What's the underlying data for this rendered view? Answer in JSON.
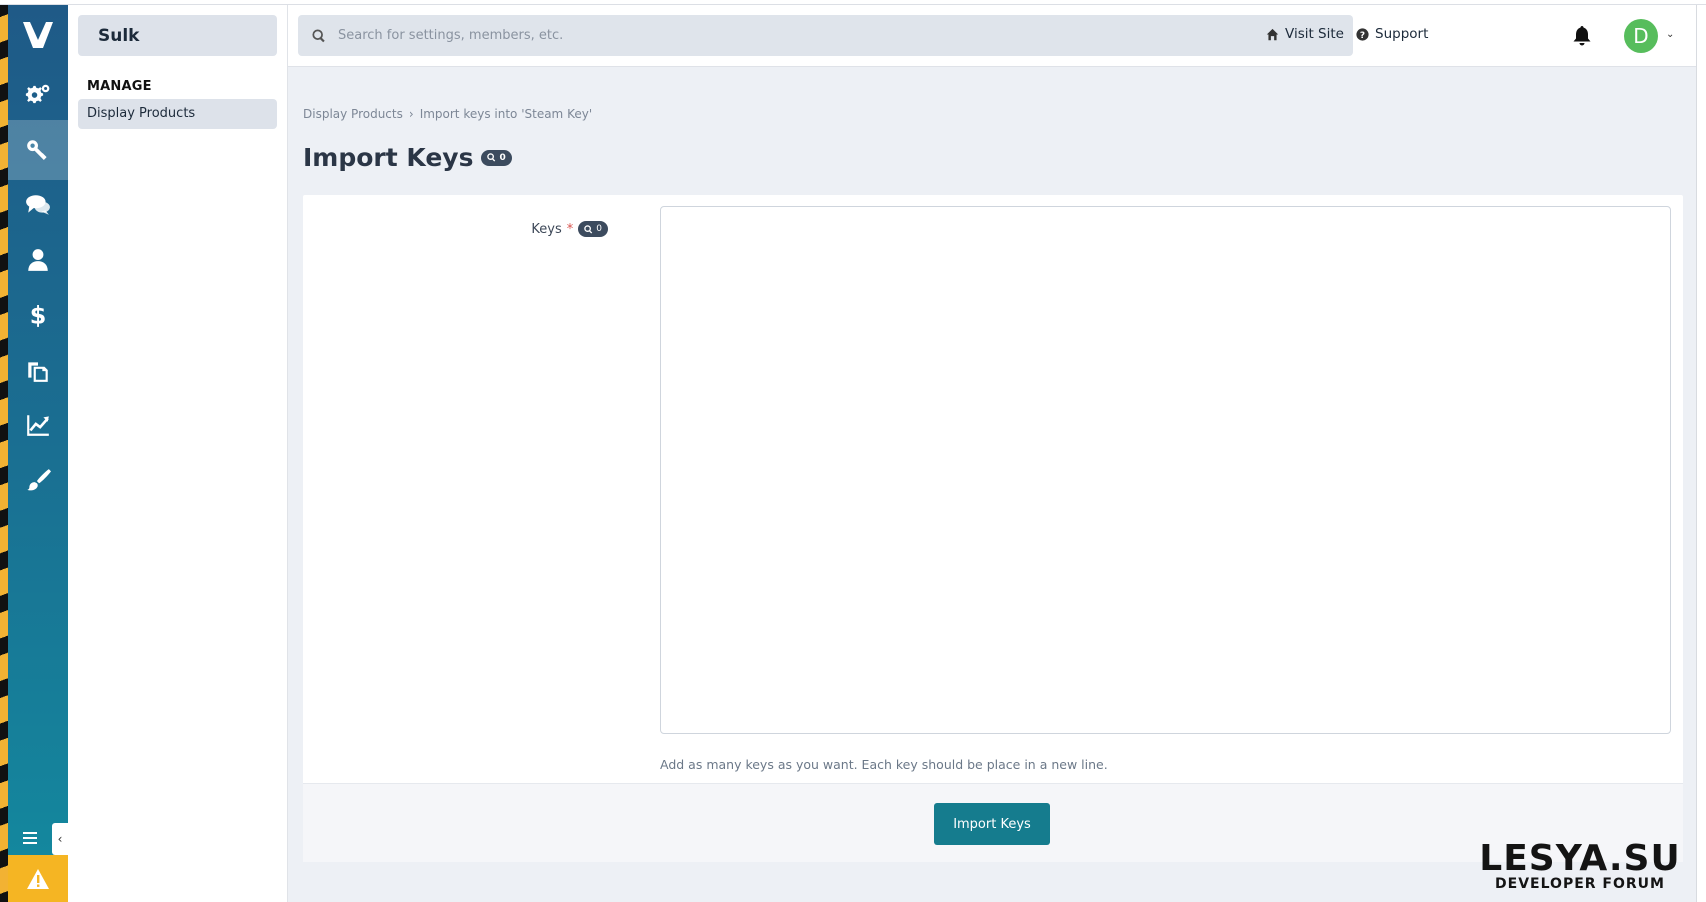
{
  "rail": {
    "items": [
      {
        "name": "settings",
        "icon": "cogs-icon"
      },
      {
        "name": "keys",
        "icon": "key-icon",
        "active": true
      },
      {
        "name": "community",
        "icon": "comments-icon"
      },
      {
        "name": "members",
        "icon": "user-icon"
      },
      {
        "name": "commerce",
        "icon": "dollar-icon"
      },
      {
        "name": "content",
        "icon": "copy-icon"
      },
      {
        "name": "stats",
        "icon": "chart-line-icon"
      },
      {
        "name": "customization",
        "icon": "brush-icon"
      }
    ],
    "toggle_icon": "menu-icon",
    "collapse_glyph": "‹",
    "warning_icon": "warning-icon"
  },
  "subnav": {
    "title": "Sulk",
    "heading": "MANAGE",
    "items": [
      {
        "label": "Display Products",
        "active": true
      }
    ]
  },
  "header": {
    "search_placeholder": "Search for settings, members, etc.",
    "visit_site": "Visit Site",
    "support": "Support",
    "avatar_letter": "D"
  },
  "breadcrumb": [
    "Display Products",
    "Import keys into 'Steam Key'"
  ],
  "page": {
    "title": "Import Keys",
    "title_badge": "0"
  },
  "form": {
    "keys_label": "Keys",
    "required_mark": "*",
    "keys_badge": "0",
    "keys_value": "",
    "hint": "Add as many keys as you want. Each key should be place in a new line.",
    "submit_label": "Import Keys"
  },
  "watermark": {
    "main": "LESYA.SU",
    "sub": "DEVELOPER FORUM"
  },
  "colors": {
    "accent": "#157c8e",
    "rail_top": "#1f5a87",
    "rail_bottom": "#138a9f",
    "avatar": "#57bd5c",
    "warning": "#f5b523"
  }
}
